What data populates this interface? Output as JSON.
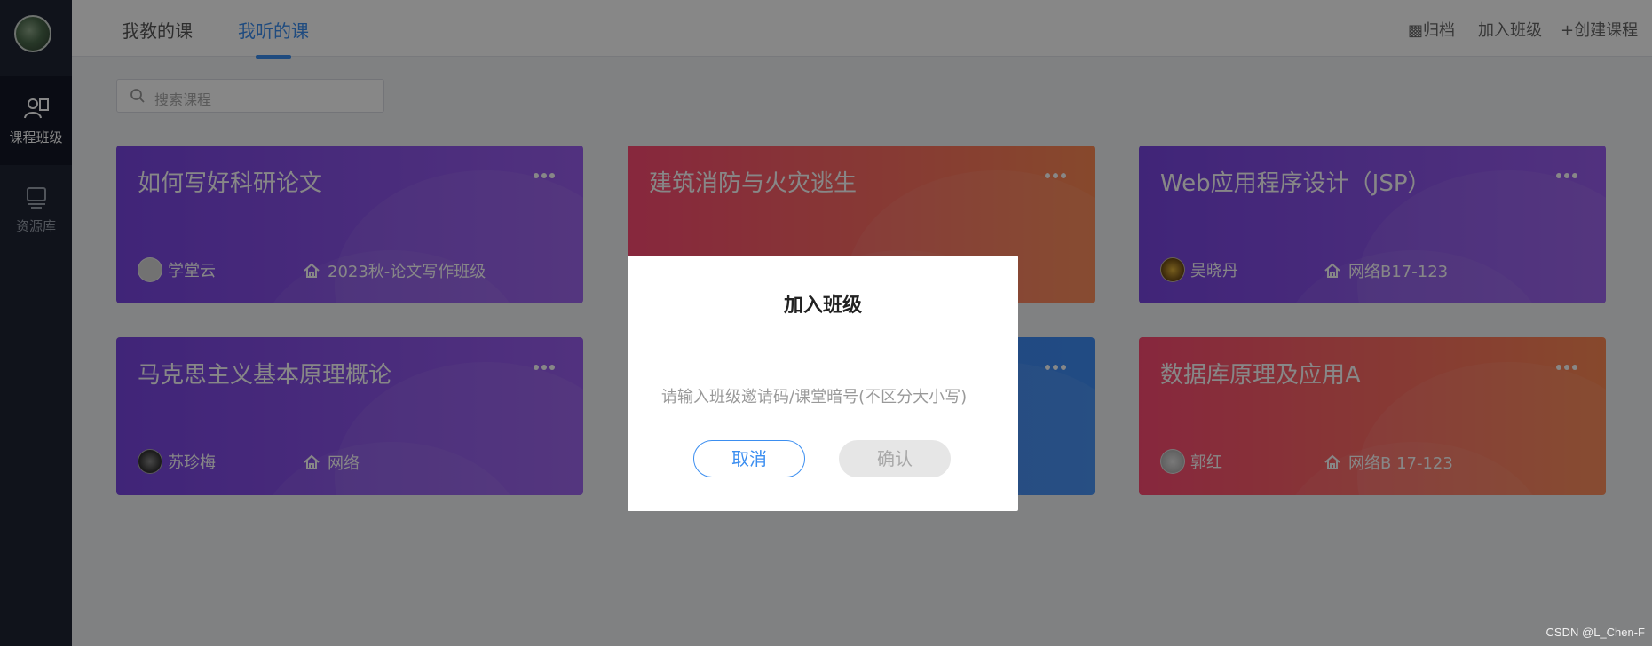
{
  "sidebar": {
    "items": [
      {
        "label": "课程班级",
        "icon": "class-icon",
        "active": true
      },
      {
        "label": "资源库",
        "icon": "library-icon",
        "active": false
      }
    ]
  },
  "topbar": {
    "tabs": [
      {
        "label": "我教的课",
        "active": false
      },
      {
        "label": "我听的课",
        "active": true
      }
    ],
    "actions": [
      {
        "label": "归档",
        "icon": "archive-icon"
      },
      {
        "label": "加入班级"
      },
      {
        "label": "创建课程",
        "icon": "plus-icon"
      }
    ]
  },
  "search": {
    "placeholder": "搜索课程"
  },
  "courses": [
    {
      "title": "如何写好科研论文",
      "teacher": "学堂云",
      "class": "2023秋-论文写作班级",
      "theme": "purple"
    },
    {
      "title": "建筑消防与火灾逃生",
      "teacher": "",
      "class": "",
      "theme": "redorange"
    },
    {
      "title": "Web应用程序设计（JSP）",
      "teacher": "吴晓丹",
      "class": "网络B17-123",
      "theme": "purple"
    },
    {
      "title": "马克思主义基本原理概论",
      "teacher": "苏珍梅",
      "class": "网络",
      "theme": "purple"
    },
    {
      "title": "",
      "teacher": "",
      "class": "",
      "theme": "blue"
    },
    {
      "title": "数据库原理及应用A",
      "teacher": "郭红",
      "class": "网络B 17-123",
      "theme": "redorange"
    }
  ],
  "dialog": {
    "title": "加入班级",
    "input_value": "",
    "hint": "请输入班级邀请码/课堂暗号(不区分大小写)",
    "cancel_label": "取消",
    "confirm_label": "确认"
  },
  "watermark": "CSDN @L_Chen-F",
  "colors": {
    "accent": "#3b8ef0",
    "sidebar": "#1f2433",
    "overlay": "rgba(0,0,0,0.47)"
  }
}
